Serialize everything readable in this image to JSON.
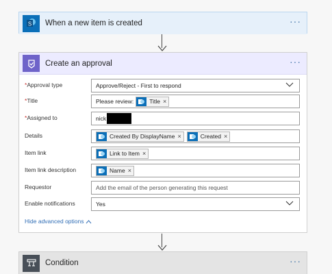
{
  "trigger": {
    "title": "When a new item is created",
    "icon": "sharepoint-icon",
    "more": "···"
  },
  "approval": {
    "title": "Create an approval",
    "icon": "approval-icon",
    "more": "···",
    "fields": {
      "approval_type": {
        "label": "Approval type",
        "required": "*",
        "value": "Approve/Reject - First to respond"
      },
      "title": {
        "label": "Title",
        "required": "*",
        "prefix": "Please review:",
        "token": "Title"
      },
      "assigned_to": {
        "label": "Assigned to",
        "required": "*",
        "value": "nick"
      },
      "details": {
        "label": "Details",
        "tokens": [
          "Created By DisplayName",
          "Created"
        ]
      },
      "item_link": {
        "label": "Item link",
        "token": "Link to Item"
      },
      "item_link_description": {
        "label": "Item link description",
        "token": "Name"
      },
      "requestor": {
        "label": "Requestor",
        "placeholder": "Add the email of the person generating this request"
      },
      "enable_notifications": {
        "label": "Enable notifications",
        "value": "Yes"
      }
    },
    "advanced_link": "Hide advanced options"
  },
  "condition": {
    "title": "Condition",
    "icon": "condition-icon",
    "more": "···"
  },
  "token_remove_glyph": "×",
  "colors": {
    "sharepoint_blue": "#0b6fb8",
    "approval_purple": "#6e63c9",
    "condition_gray": "#484f58",
    "link_blue": "#2f6db5"
  }
}
